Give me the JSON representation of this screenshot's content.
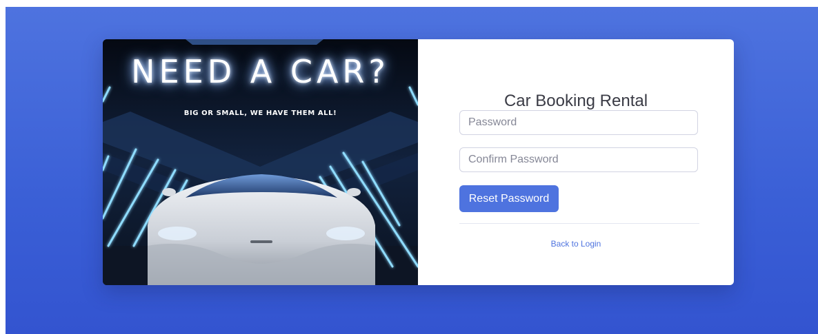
{
  "promo": {
    "headline": "NEED A CAR?",
    "subline": "BIG OR SMALL, WE HAVE THEM ALL!",
    "image": "white-sports-car-neon-tunnel"
  },
  "form": {
    "title": "Car Booking Rental",
    "password_placeholder": "Password",
    "confirm_placeholder": "Confirm Password",
    "reset_label": "Reset Password",
    "back_link": "Back to Login"
  },
  "colors": {
    "background": "#4e73df",
    "accent": "#4e73df",
    "card": "#ffffff"
  }
}
